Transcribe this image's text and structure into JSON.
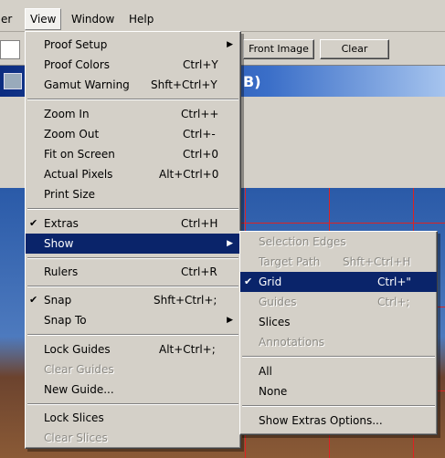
{
  "menubar": {
    "items": [
      {
        "label": "er"
      },
      {
        "label": "View"
      },
      {
        "label": "Window"
      },
      {
        "label": "Help"
      }
    ]
  },
  "options_bar": {
    "front_image_label": "Front Image",
    "clear_label": "Clear"
  },
  "document": {
    "title_fragment": "B)"
  },
  "view_menu": {
    "items": [
      {
        "label": "Proof Setup",
        "submenu": true
      },
      {
        "label": "Proof Colors",
        "shortcut": "Ctrl+Y"
      },
      {
        "label": "Gamut Warning",
        "shortcut": "Shft+Ctrl+Y"
      },
      {
        "label": "Zoom In",
        "shortcut": "Ctrl++"
      },
      {
        "label": "Zoom Out",
        "shortcut": "Ctrl+-"
      },
      {
        "label": "Fit on Screen",
        "shortcut": "Ctrl+0"
      },
      {
        "label": "Actual Pixels",
        "shortcut": "Alt+Ctrl+0"
      },
      {
        "label": "Print Size"
      },
      {
        "label": "Extras",
        "shortcut": "Ctrl+H",
        "checked": true
      },
      {
        "label": "Show",
        "submenu": true,
        "highlighted": true
      },
      {
        "label": "Rulers",
        "shortcut": "Ctrl+R"
      },
      {
        "label": "Snap",
        "shortcut": "Shft+Ctrl+;",
        "checked": true
      },
      {
        "label": "Snap To",
        "submenu": true
      },
      {
        "label": "Lock Guides",
        "shortcut": "Alt+Ctrl+;"
      },
      {
        "label": "Clear Guides",
        "disabled": true
      },
      {
        "label": "New Guide..."
      },
      {
        "label": "Lock Slices"
      },
      {
        "label": "Clear Slices",
        "disabled": true
      }
    ]
  },
  "show_submenu": {
    "items": [
      {
        "label": "Selection Edges",
        "disabled": true
      },
      {
        "label": "Target Path",
        "shortcut": "Shft+Ctrl+H",
        "disabled": true
      },
      {
        "label": "Grid",
        "shortcut": "Ctrl+\"",
        "checked": true,
        "highlighted": true
      },
      {
        "label": "Guides",
        "shortcut": "Ctrl+;",
        "disabled": true
      },
      {
        "label": "Slices"
      },
      {
        "label": "Annotations",
        "disabled": true
      },
      {
        "label": "All"
      },
      {
        "label": "None"
      },
      {
        "label": "Show Extras Options..."
      }
    ]
  },
  "glyphs": {
    "check": "✔",
    "arrow": "▶"
  }
}
